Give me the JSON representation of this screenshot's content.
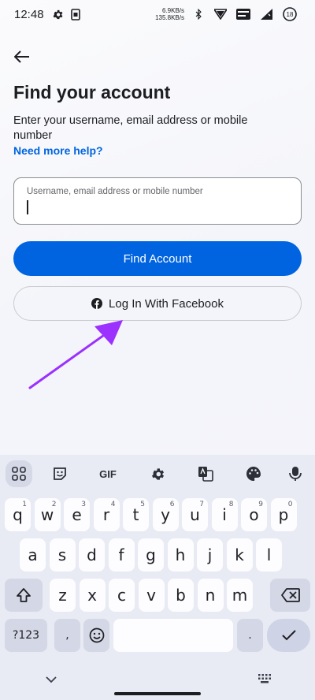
{
  "status_bar": {
    "time": "12:48",
    "net_up": "6.9KB/s",
    "net_down": "135.8KB/s",
    "battery": "18",
    "icons": [
      "gear-icon",
      "sim-icon",
      "bluetooth-icon",
      "wifi-icon",
      "volte-icon",
      "signal-icon",
      "battery-icon"
    ]
  },
  "page": {
    "title": "Find your account",
    "subtitle": "Enter your username, email address or mobile number",
    "help_link": "Need more help?",
    "input_label": "Username, email address or mobile number",
    "find_button": "Find Account",
    "facebook_button": "Log In With Facebook",
    "accent_color": "#0064e0",
    "annotation_color": "#9b30ff"
  },
  "keyboard": {
    "toolbar": [
      "apps-grid-icon",
      "sticker-icon",
      "GIF",
      "settings-icon",
      "translate-icon",
      "palette-icon",
      "mic-icon"
    ],
    "gif_label": "GIF",
    "row1": [
      [
        "q",
        "1"
      ],
      [
        "w",
        "2"
      ],
      [
        "e",
        "3"
      ],
      [
        "r",
        "4"
      ],
      [
        "t",
        "5"
      ],
      [
        "y",
        "6"
      ],
      [
        "u",
        "7"
      ],
      [
        "i",
        "8"
      ],
      [
        "o",
        "9"
      ],
      [
        "p",
        "0"
      ]
    ],
    "row2": [
      "a",
      "s",
      "d",
      "f",
      "g",
      "h",
      "j",
      "k",
      "l"
    ],
    "row3": [
      "z",
      "x",
      "c",
      "v",
      "b",
      "n",
      "m"
    ],
    "symbols_key": "?123",
    "comma": ",",
    "period": "."
  }
}
